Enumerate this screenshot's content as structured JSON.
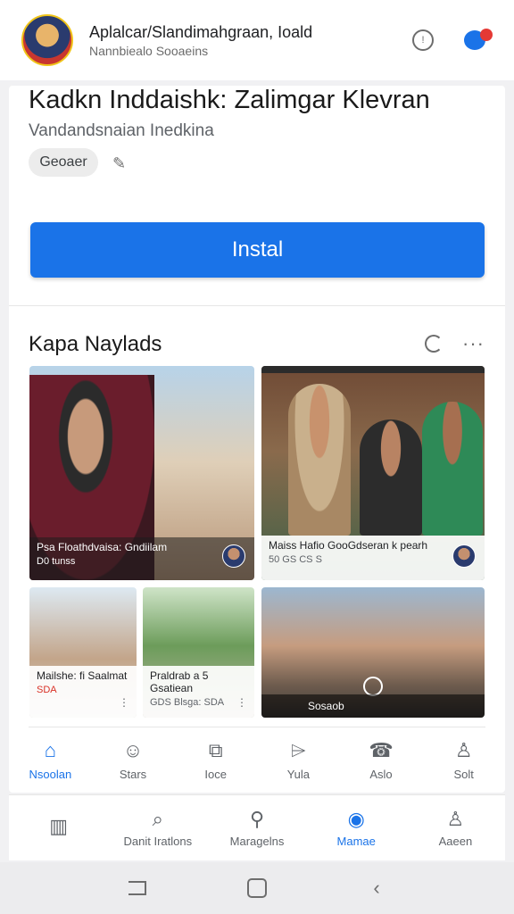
{
  "header": {
    "title": "Aplalcar/Slandimahgraan, Ioald",
    "subtitle": "Nannbiealo Sooaeins",
    "icons": [
      "clock-icon",
      "messenger-icon"
    ]
  },
  "app": {
    "title": "Kadkn Inddaishk: Zalimgar Klevran",
    "subtitle": "Vandandsnaian Inedkina",
    "chip_label": "Geoaer",
    "install_label": "Instal",
    "accent_color": "#1a73e8"
  },
  "media": {
    "section_title": "Kapa Naylads",
    "tiles": [
      {
        "title": "Psa Floathdvaisa: Gndiilam",
        "meta": "D0 tunss"
      },
      {
        "title": "Maiss Hafio GooGdseran k pearh",
        "meta": "50 GS CS S"
      },
      {
        "title": "Mailshe: fi Saalmat",
        "meta": "SDA"
      },
      {
        "title": "Praldrab a 5 Gsatiean",
        "meta": "GDS Blsga: SDA"
      },
      {
        "title": "",
        "meta": "Sosaob"
      }
    ]
  },
  "categories": [
    {
      "label": "Nsoolan",
      "icon": "⌂",
      "name": "home-icon",
      "active": true
    },
    {
      "label": "Stars",
      "icon": "☺",
      "name": "smile-icon",
      "active": false
    },
    {
      "label": "Ioce",
      "icon": "⧉",
      "name": "copy-icon",
      "active": false
    },
    {
      "label": "Yula",
      "icon": "⌲",
      "name": "feedback-icon",
      "active": false
    },
    {
      "label": "Aslo",
      "icon": "☎",
      "name": "robot-icon",
      "active": false
    },
    {
      "label": "Solt",
      "icon": "♙",
      "name": "user-check-icon",
      "active": false
    }
  ],
  "bottom_nav": [
    {
      "label": "",
      "icon": "▥",
      "name": "stats-icon",
      "active": false
    },
    {
      "label": "Danit Iratlons",
      "icon": "⌕",
      "name": "search-zoom-icon",
      "active": false
    },
    {
      "label": "Maragelns",
      "icon": "⚲",
      "name": "search-icon",
      "active": false
    },
    {
      "label": "Mamae",
      "icon": "◉",
      "name": "messenger-icon",
      "active": true
    },
    {
      "label": "Aaeen",
      "icon": "♙",
      "name": "account-icon",
      "active": false
    }
  ]
}
